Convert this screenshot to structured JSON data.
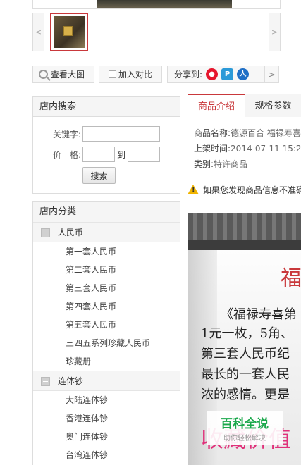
{
  "gallery": {
    "prev_arrow": "<",
    "next_arrow": ">"
  },
  "actions": {
    "zoom_label": "查看大图",
    "compare_label": "加入对比",
    "share_label": "分享到:",
    "share_next": ">"
  },
  "search": {
    "title": "店内搜索",
    "keyword_label": "关键字:",
    "price_label": "价　格:",
    "to_label": "到",
    "keyword_value": "",
    "price_min": "",
    "price_max": "",
    "button_label": "搜索"
  },
  "categories": {
    "title": "店内分类",
    "groups": [
      {
        "label": "人民币",
        "items": [
          "第一套人民币",
          "第二套人民币",
          "第三套人民币",
          "第四套人民币",
          "第五套人民币",
          "三四五系列珍藏人民币",
          "珍藏册"
        ]
      },
      {
        "label": "连体钞",
        "items": [
          "大陆连体钞",
          "香港连体钞",
          "奥门连体钞",
          "台湾连体钞"
        ]
      }
    ]
  },
  "product": {
    "tabs": [
      "商品介绍",
      "规格参数"
    ],
    "name_label": "商品名称:",
    "name_value": "德源百合 福禄寿喜",
    "date_label": "上架时间:",
    "date_value": "2014-07-11 15:2",
    "category_label": "类别:",
    "category_value": "特许商品",
    "notice": "如果您发现商品信息不准确"
  },
  "image_text": {
    "title": "福",
    "lines": [
      "《福禄寿喜第",
      "1元一枚，5角、",
      "第三套人民币纪",
      "最长的一套人民",
      "浓的感情。更是"
    ],
    "pink": "收藏价值"
  },
  "watermark": {
    "title": "百科全说",
    "subtitle": "助你轻松解决"
  }
}
